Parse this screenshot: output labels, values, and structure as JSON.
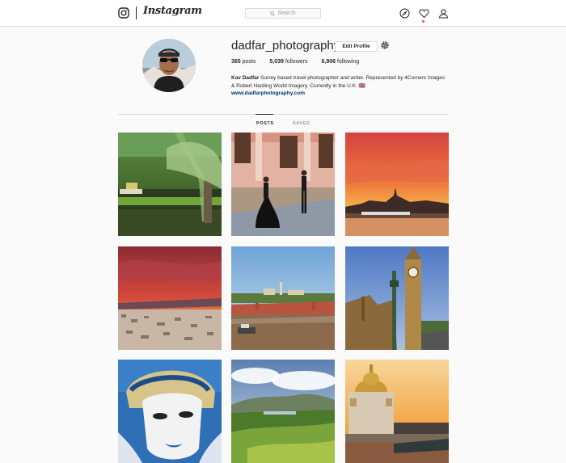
{
  "header": {
    "app_name": "Instagram",
    "search_placeholder": "Search",
    "icons": [
      "instagram-logo-icon",
      "search-icon",
      "compass-icon",
      "heart-icon",
      "person-icon"
    ]
  },
  "profile": {
    "username": "dadfar_photography",
    "edit_profile_label": "Edit Profile",
    "posts_count": "365",
    "posts_label": "posts",
    "followers_count": "5,039",
    "followers_label": "followers",
    "following_count": "6,906",
    "following_label": "following",
    "bio_name": "Kav Dadfar",
    "bio_text": "Surrey based travel photographer and writer. Represented by 4Corners Images & Robert Harding World Imagery. Currently in the U.K. 🇬🇧",
    "website": "www.dadfarphotography.com"
  },
  "tabs": {
    "posts": "POSTS",
    "saved": "SAVED"
  },
  "colors": {
    "link": "#003569",
    "border": "#dbdbdb",
    "notification": "#ed4956"
  },
  "posts": [
    {
      "subject": "swamp-trees-photo"
    },
    {
      "subject": "flamenco-dancers-photo"
    },
    {
      "subject": "sunset-city-photo"
    },
    {
      "subject": "red-sky-cityscape-photo"
    },
    {
      "subject": "moscow-river-photo"
    },
    {
      "subject": "big-ben-photo"
    },
    {
      "subject": "venetian-mask-photo"
    },
    {
      "subject": "green-valley-photo"
    },
    {
      "subject": "cathedral-sunset-photo"
    }
  ]
}
